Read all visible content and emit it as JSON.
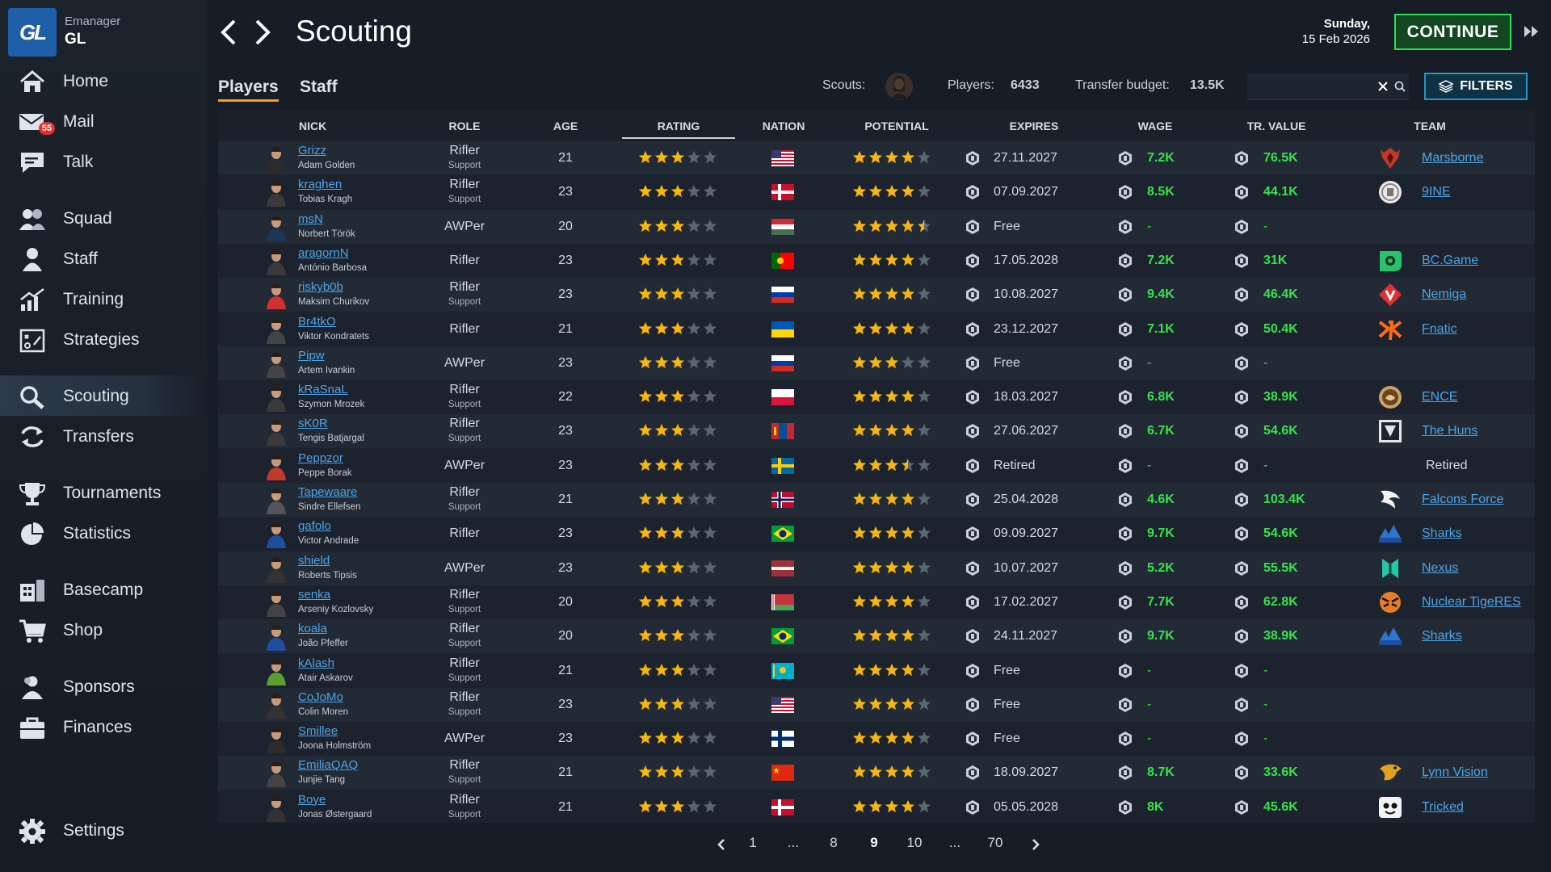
{
  "brand": {
    "logo_text": "GL",
    "subtitle": "Emanager",
    "name": "GL"
  },
  "nav": {
    "items": [
      {
        "label": "Home",
        "icon": "home-icon"
      },
      {
        "label": "Mail",
        "icon": "mail-icon",
        "badge": "55"
      },
      {
        "label": "Talk",
        "icon": "chat-icon"
      },
      {
        "label": "Squad",
        "icon": "squad-icon"
      },
      {
        "label": "Staff",
        "icon": "staff-icon"
      },
      {
        "label": "Training",
        "icon": "training-icon"
      },
      {
        "label": "Strategies",
        "icon": "strategies-icon"
      },
      {
        "label": "Scouting",
        "icon": "scouting-icon",
        "active": true
      },
      {
        "label": "Transfers",
        "icon": "transfers-icon"
      },
      {
        "label": "Tournaments",
        "icon": "trophy-icon"
      },
      {
        "label": "Statistics",
        "icon": "statistics-icon"
      },
      {
        "label": "Basecamp",
        "icon": "basecamp-icon"
      },
      {
        "label": "Shop",
        "icon": "cart-icon"
      },
      {
        "label": "Sponsors",
        "icon": "sponsors-icon"
      },
      {
        "label": "Finances",
        "icon": "briefcase-icon"
      },
      {
        "label": "Settings",
        "icon": "gear-icon"
      }
    ]
  },
  "header": {
    "title": "Scouting",
    "date_day": "Sunday,",
    "date": "15 Feb 2026",
    "continue_label": "CONTINUE"
  },
  "tabs": [
    {
      "label": "Players",
      "active": true
    },
    {
      "label": "Staff",
      "active": false
    }
  ],
  "stats": {
    "scouts_label": "Scouts:",
    "players_label": "Players:",
    "players_value": "6433",
    "budget_label": "Transfer budget:",
    "budget_value": "13.5K"
  },
  "search": {
    "value": "",
    "placeholder": ""
  },
  "filters_label": "FILTERS",
  "columns": {
    "nick": "NICK",
    "role": "ROLE",
    "age": "AGE",
    "rating": "RATING",
    "nation": "NATION",
    "potential": "POTENTIAL",
    "expires": "EXPIRES",
    "wage": "WAGE",
    "tr_value": "TR. VALUE",
    "team": "TEAM"
  },
  "colors": {
    "accent": "#39e24c",
    "link": "#4fa4e6",
    "tab_underline": "#f2a024",
    "continue_border": "#2fdc5a",
    "filters_border": "#2896c0"
  },
  "rows": [
    {
      "nick": "Grizz",
      "real": "Adam Golden",
      "role": "Rifler",
      "role2": "Support",
      "age": "21",
      "rating": 3,
      "nation": "us",
      "potential": 4,
      "expires": "27.11.2027",
      "wage": "7.2K",
      "value": "76.5K",
      "team": "Marsborne",
      "team_logo": "marsborne-logo"
    },
    {
      "nick": "kraghen",
      "real": "Tobias Kragh",
      "role": "Rifler",
      "role2": "Support",
      "age": "23",
      "rating": 3,
      "nation": "dk",
      "potential": 4,
      "expires": "07.09.2027",
      "wage": "8.5K",
      "value": "44.1K",
      "team": "9INE",
      "team_logo": "9ine-logo"
    },
    {
      "nick": "msN",
      "real": "Norbert Török",
      "role": "AWPer",
      "role2": "",
      "age": "20",
      "rating": 3,
      "nation": "hu",
      "potential": 4.5,
      "expires": "Free",
      "wage": "-",
      "value": "-",
      "team": "",
      "team_logo": ""
    },
    {
      "nick": "aragornN",
      "real": "António Barbosa",
      "role": "Rifler",
      "role2": "",
      "age": "23",
      "rating": 3,
      "nation": "pt",
      "potential": 4,
      "expires": "17.05.2028",
      "wage": "7.2K",
      "value": "31K",
      "team": "BC.Game",
      "team_logo": "bcgame-logo"
    },
    {
      "nick": "riskyb0b",
      "real": "Maksim Churikov",
      "role": "Rifler",
      "role2": "Support",
      "age": "23",
      "rating": 3,
      "nation": "ru",
      "potential": 4,
      "expires": "10.08.2027",
      "wage": "9.4K",
      "value": "46.4K",
      "team": "Nemiga",
      "team_logo": "nemiga-logo"
    },
    {
      "nick": "Br4tkO",
      "real": "Viktor Kondratets",
      "role": "Rifler",
      "role2": "",
      "age": "21",
      "rating": 3,
      "nation": "ua",
      "potential": 4,
      "expires": "23.12.2027",
      "wage": "7.1K",
      "value": "50.4K",
      "team": "Fnatic",
      "team_logo": "fnatic-logo"
    },
    {
      "nick": "Pipw",
      "real": "Artem Ivankin",
      "role": "AWPer",
      "role2": "",
      "age": "23",
      "rating": 3,
      "nation": "ru",
      "potential": 3,
      "expires": "Free",
      "wage": "-",
      "value": "-",
      "team": "",
      "team_logo": ""
    },
    {
      "nick": "kRaSnaL",
      "real": "Szymon Mrozek",
      "role": "Rifler",
      "role2": "Support",
      "age": "22",
      "rating": 3,
      "nation": "pl",
      "potential": 4,
      "expires": "18.03.2027",
      "wage": "6.8K",
      "value": "38.9K",
      "team": "ENCE",
      "team_logo": "ence-logo"
    },
    {
      "nick": "sK0R",
      "real": "Tengis Batjargal",
      "role": "Rifler",
      "role2": "Support",
      "age": "23",
      "rating": 3,
      "nation": "mn",
      "potential": 4,
      "expires": "27.06.2027",
      "wage": "6.7K",
      "value": "54.6K",
      "team": "The Huns",
      "team_logo": "huns-logo"
    },
    {
      "nick": "Peppzor",
      "real": "Peppe Borak",
      "role": "AWPer",
      "role2": "",
      "age": "23",
      "rating": 3,
      "nation": "se",
      "potential": 3.5,
      "expires": "Retired",
      "wage": "-",
      "value": "-",
      "team": "Retired",
      "team_logo": "",
      "team_plain": true
    },
    {
      "nick": "Tapewaare",
      "real": "Sindre Ellefsen",
      "role": "Rifler",
      "role2": "Support",
      "age": "21",
      "rating": 3,
      "nation": "no",
      "potential": 4,
      "expires": "25.04.2028",
      "wage": "4.6K",
      "value": "103.4K",
      "team": "Falcons Force",
      "team_logo": "falcons-logo"
    },
    {
      "nick": "gafolo",
      "real": "Victor Andrade",
      "role": "Rifler",
      "role2": "",
      "age": "23",
      "rating": 3,
      "nation": "br",
      "potential": 4,
      "expires": "09.09.2027",
      "wage": "9.7K",
      "value": "54.6K",
      "team": "Sharks",
      "team_logo": "sharks-logo"
    },
    {
      "nick": "shield",
      "real": "Roberts Tipsis",
      "role": "AWPer",
      "role2": "",
      "age": "23",
      "rating": 3,
      "nation": "lv",
      "potential": 4,
      "expires": "10.07.2027",
      "wage": "5.2K",
      "value": "55.5K",
      "team": "Nexus",
      "team_logo": "nexus-logo"
    },
    {
      "nick": "senka",
      "real": "Arseniy Kozlovsky",
      "role": "Rifler",
      "role2": "Support",
      "age": "20",
      "rating": 3,
      "nation": "by",
      "potential": 4,
      "expires": "17.02.2027",
      "wage": "7.7K",
      "value": "62.8K",
      "team": "Nuclear TigeRES",
      "team_logo": "tigeres-logo"
    },
    {
      "nick": "koala",
      "real": "João Pfeffer",
      "role": "Rifler",
      "role2": "Support",
      "age": "20",
      "rating": 3,
      "nation": "br",
      "potential": 4,
      "expires": "24.11.2027",
      "wage": "9.7K",
      "value": "38.9K",
      "team": "Sharks",
      "team_logo": "sharks-logo"
    },
    {
      "nick": "kAlash",
      "real": "Atair Askarov",
      "role": "Rifler",
      "role2": "Support",
      "age": "21",
      "rating": 3,
      "nation": "kz",
      "potential": 4,
      "expires": "Free",
      "wage": "-",
      "value": "-",
      "team": "",
      "team_logo": ""
    },
    {
      "nick": "CoJoMo",
      "real": "Colin Moren",
      "role": "Rifler",
      "role2": "Support",
      "age": "23",
      "rating": 3,
      "nation": "us",
      "potential": 4,
      "expires": "Free",
      "wage": "-",
      "value": "-",
      "team": "",
      "team_logo": ""
    },
    {
      "nick": "Smillee",
      "real": "Joona Holmström",
      "role": "AWPer",
      "role2": "",
      "age": "23",
      "rating": 3,
      "nation": "fi",
      "potential": 4,
      "expires": "Free",
      "wage": "-",
      "value": "-",
      "team": "",
      "team_logo": ""
    },
    {
      "nick": "EmiliaQAQ",
      "real": "Junjie Tang",
      "role": "Rifler",
      "role2": "Support",
      "age": "21",
      "rating": 3,
      "nation": "cn",
      "potential": 4,
      "expires": "18.09.2027",
      "wage": "8.7K",
      "value": "33.6K",
      "team": "Lynn Vision",
      "team_logo": "lynn-logo"
    },
    {
      "nick": "Boye",
      "real": "Jonas Østergaard",
      "role": "Rifler",
      "role2": "Support",
      "age": "21",
      "rating": 3,
      "nation": "dk",
      "potential": 4,
      "expires": "05.05.2028",
      "wage": "8K",
      "value": "45.6K",
      "team": "Tricked",
      "team_logo": "tricked-logo"
    }
  ],
  "pagination": {
    "pages": [
      "1",
      "...",
      "8",
      "9",
      "10",
      "...",
      "70"
    ],
    "current": "9"
  }
}
